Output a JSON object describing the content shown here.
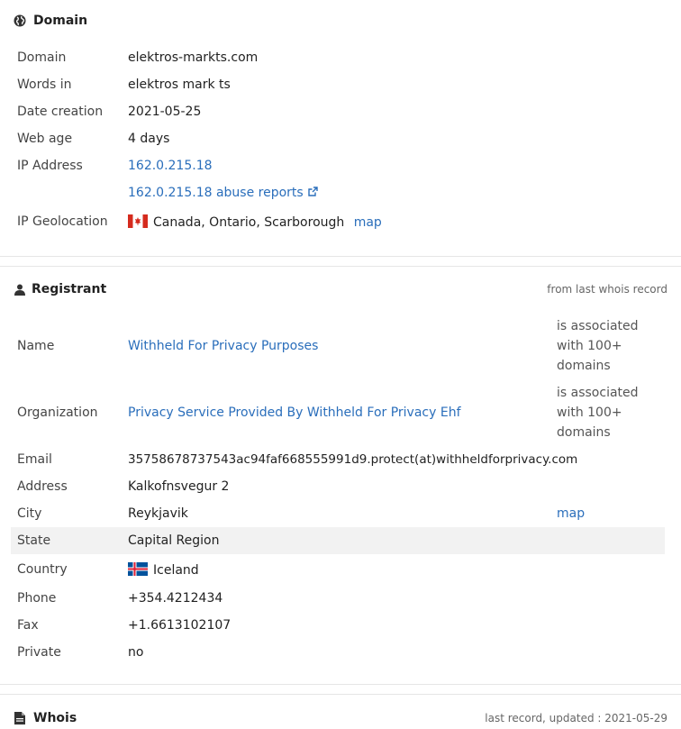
{
  "domain_section": {
    "title": "Domain",
    "rows": [
      {
        "label": "Domain",
        "value": "elektros-markts.com"
      },
      {
        "label": "Words in",
        "value": "elektros mark ts"
      },
      {
        "label": "Date creation",
        "value": "2021-05-25"
      },
      {
        "label": "Web age",
        "value": "4 days"
      },
      {
        "label": "IP Address",
        "value": "162.0.215.18"
      }
    ],
    "abuse_link": "162.0.215.18 abuse reports",
    "geo_label": "IP Geolocation",
    "geo_value": "Canada, Ontario, Scarborough",
    "geo_map": "map"
  },
  "registrant": {
    "title": "Registrant",
    "note": "from last whois record",
    "name_label": "Name",
    "name_value": "Withheld For Privacy Purposes",
    "name_assoc": "is associated with 100+ domains",
    "org_label": "Organization",
    "org_value": "Privacy Service Provided By Withheld For Privacy Ehf",
    "org_assoc": "is associated with 100+ domains",
    "email_label": "Email",
    "email_value": "35758678737543ac94faf668555991d9.protect(at)withheldforprivacy.com",
    "address_label": "Address",
    "address_value": "Kalkofnsvegur 2",
    "city_label": "City",
    "city_value": "Reykjavik",
    "city_map": "map",
    "state_label": "State",
    "state_value": "Capital Region",
    "country_label": "Country",
    "country_value": "Iceland",
    "phone_label": "Phone",
    "phone_value": "+354.4212434",
    "fax_label": "Fax",
    "fax_value": "+1.6613102107",
    "private_label": "Private",
    "private_value": "no"
  },
  "whois": {
    "title": "Whois",
    "note": "last record, updated : 2021-05-29"
  },
  "colors": {
    "link": "#2a6ebb",
    "highlight_row": "#f2f2f2"
  },
  "icons": [
    "globe-icon",
    "external-link-icon",
    "canada-flag-icon",
    "user-icon",
    "iceland-flag-icon",
    "document-icon"
  ]
}
